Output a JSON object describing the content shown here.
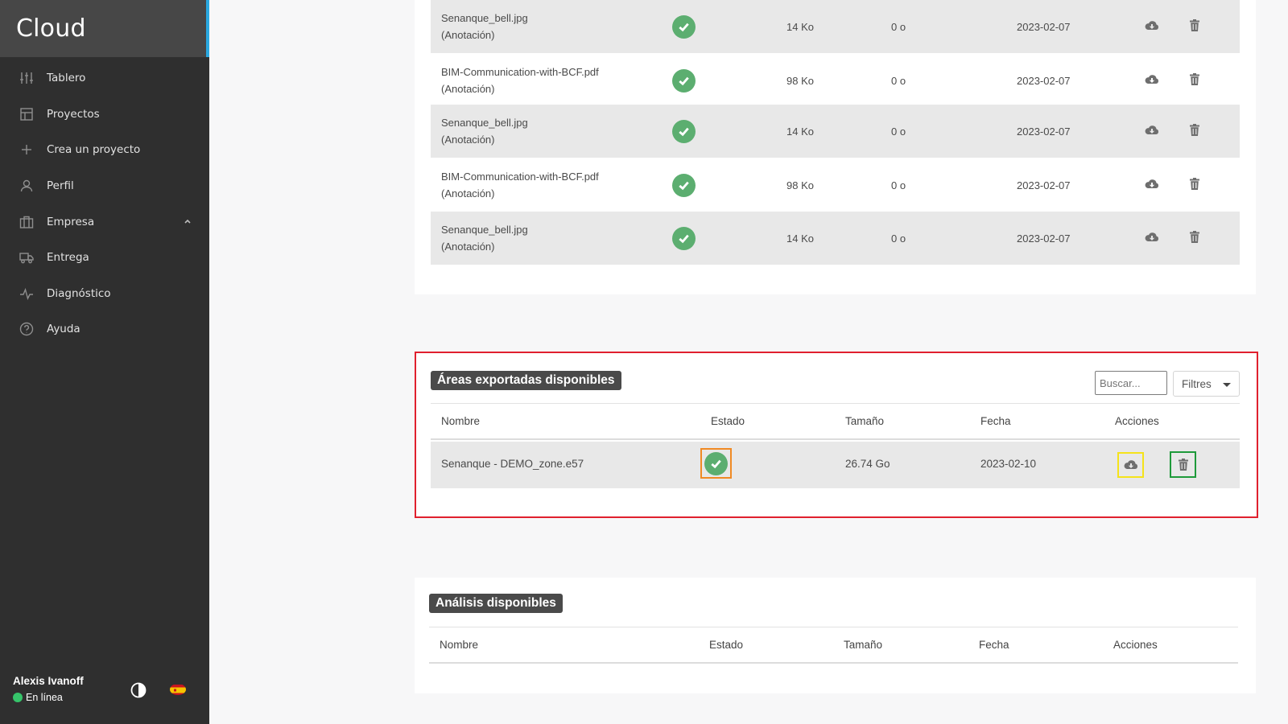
{
  "app": {
    "title": "Cloud"
  },
  "sidebar": {
    "items": [
      {
        "label": "Tablero",
        "icon": "sliders-icon"
      },
      {
        "label": "Proyectos",
        "icon": "layout-icon"
      },
      {
        "label": "Crea un proyecto",
        "icon": "plus-icon"
      },
      {
        "label": "Perfil",
        "icon": "user-icon"
      },
      {
        "label": "Empresa",
        "icon": "briefcase-icon"
      },
      {
        "label": "Entrega",
        "icon": "truck-icon"
      },
      {
        "label": "Diagnóstico",
        "icon": "activity-icon"
      },
      {
        "label": "Ayuda",
        "icon": "help-circle-icon"
      }
    ],
    "user": {
      "name": "Alexis Ivanoff",
      "status": "En línea",
      "status_color": "#36c46a"
    }
  },
  "files": {
    "rows": [
      {
        "name": "Senanque_bell.jpg",
        "type": "(Anotación)",
        "size": "14 Ko",
        "downloaded": "0 o",
        "date": "2023-02-07"
      },
      {
        "name": "BIM-Communication-with-BCF.pdf",
        "type": "(Anotación)",
        "size": "98 Ko",
        "downloaded": "0 o",
        "date": "2023-02-07"
      },
      {
        "name": "Senanque_bell.jpg",
        "type": "(Anotación)",
        "size": "14 Ko",
        "downloaded": "0 o",
        "date": "2023-02-07"
      },
      {
        "name": "BIM-Communication-with-BCF.pdf",
        "type": "(Anotación)",
        "size": "98 Ko",
        "downloaded": "0 o",
        "date": "2023-02-07"
      },
      {
        "name": "Senanque_bell.jpg",
        "type": "(Anotación)",
        "size": "14 Ko",
        "downloaded": "0 o",
        "date": "2023-02-07"
      }
    ]
  },
  "exported": {
    "title": "Áreas exportadas disponibles",
    "search_placeholder": "Buscar...",
    "filters_label": "Filtres",
    "columns": {
      "name": "Nombre",
      "state": "Estado",
      "size": "Tamaño",
      "date": "Fecha",
      "actions": "Acciones"
    },
    "rows": [
      {
        "name": "Senanque - DEMO_zone.e57",
        "size": "26.74 Go",
        "date": "2023-02-10"
      }
    ]
  },
  "analysis": {
    "title": "Análisis disponibles",
    "columns": {
      "name": "Nombre",
      "state": "Estado",
      "size": "Tamaño",
      "date": "Fecha",
      "actions": "Acciones"
    }
  },
  "colors": {
    "accent": "#2aa8e0",
    "success": "#5cae70",
    "highlight_red": "#e0202e",
    "highlight_orange": "#f08a24",
    "highlight_yellow": "#f5e31a",
    "highlight_green": "#1e9a3a"
  }
}
